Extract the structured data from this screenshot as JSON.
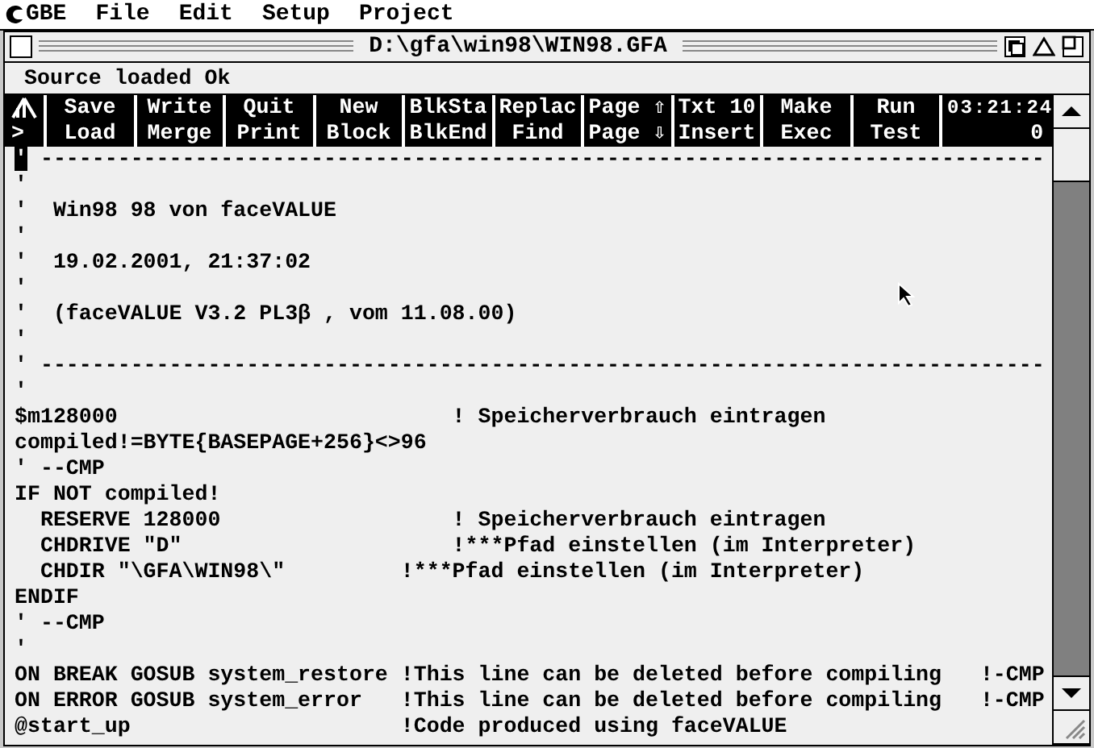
{
  "menu_bar": {
    "app": "GBE",
    "items": [
      "File",
      "Edit",
      "Setup",
      "Project"
    ]
  },
  "window": {
    "title": "D:\\gfa\\win98\\WIN98.GFA",
    "status": "Source loaded Ok"
  },
  "toolbar": {
    "row_1": [
      "Save",
      "Write",
      "Quit",
      "New",
      "BlkSta",
      "Replac",
      "Page ⇧",
      "Txt 10",
      "Make",
      "Run"
    ],
    "row_2": [
      "Load",
      "Merge",
      "Print",
      "Block",
      "BlkEnd",
      "Find",
      "Page ⇩",
      "Insert",
      "Exec",
      "Test"
    ],
    "row_2_marker": ">",
    "clock": "03:21:24",
    "counter": "0"
  },
  "editor": {
    "lines": [
      {
        "text": "' ------------------------------------------------------------------------------",
        "cursor": true
      },
      {
        "text": "'",
        "cursor": false
      },
      {
        "text": "'  Win98 98 von faceVALUE",
        "cursor": false
      },
      {
        "text": "'",
        "cursor": false
      },
      {
        "text": "'  19.02.2001, 21:37:02",
        "cursor": false
      },
      {
        "text": "'",
        "cursor": false
      },
      {
        "text": "'  (faceVALUE V3.2 PL3β , vom 11.08.00)",
        "cursor": false
      },
      {
        "text": "'",
        "cursor": false
      },
      {
        "text": "' ------------------------------------------------------------------------------",
        "cursor": false
      },
      {
        "text": "'",
        "cursor": false
      },
      {
        "text": "$m128000                          ! Speicherverbrauch eintragen",
        "cursor": false
      },
      {
        "text": "compiled!=BYTE{BASEPAGE+256}<>96",
        "cursor": false
      },
      {
        "text": "' --CMP",
        "cursor": false
      },
      {
        "text": "IF NOT compiled!",
        "cursor": false
      },
      {
        "text": "  RESERVE 128000                  ! Speicherverbrauch eintragen",
        "cursor": false
      },
      {
        "text": "  CHDRIVE \"D\"                     !***Pfad einstellen (im Interpreter)",
        "cursor": false
      },
      {
        "text": "  CHDIR \"\\GFA\\WIN98\\\"         !***Pfad einstellen (im Interpreter)",
        "cursor": false
      },
      {
        "text": "ENDIF",
        "cursor": false
      },
      {
        "text": "' --CMP",
        "cursor": false
      },
      {
        "text": "'",
        "cursor": false
      },
      {
        "text": "ON BREAK GOSUB system_restore !This line can be deleted before compiling   !-CMP",
        "cursor": false
      },
      {
        "text": "ON ERROR GOSUB system_error   !This line can be deleted before compiling   !-CMP",
        "cursor": false
      },
      {
        "text": "@start_up                     !Code produced using faceVALUE",
        "cursor": false
      }
    ]
  }
}
